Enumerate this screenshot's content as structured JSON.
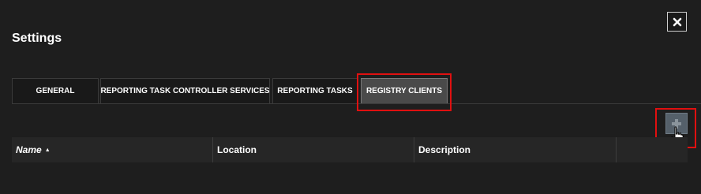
{
  "window": {
    "title": "Settings"
  },
  "tabs": [
    {
      "label": "GENERAL",
      "active": false
    },
    {
      "label": "REPORTING TASK CONTROLLER SERVICES",
      "active": false
    },
    {
      "label": "REPORTING TASKS",
      "active": false
    },
    {
      "label": "REGISTRY CLIENTS",
      "active": true
    }
  ],
  "table": {
    "columns": [
      {
        "label": "Name",
        "sort": "ascending"
      },
      {
        "label": "Location"
      },
      {
        "label": "Description"
      },
      {
        "label": ""
      }
    ],
    "rows": []
  },
  "icons": {
    "close": "close-icon",
    "add": "add-icon",
    "sort": "sort-ascending-icon",
    "cursor": "hand-pointer-icon"
  },
  "colors": {
    "background": "#1e1e1e",
    "active_tab": "#4a4a4a",
    "highlight": "#e01010",
    "add_button": "#55606a"
  }
}
